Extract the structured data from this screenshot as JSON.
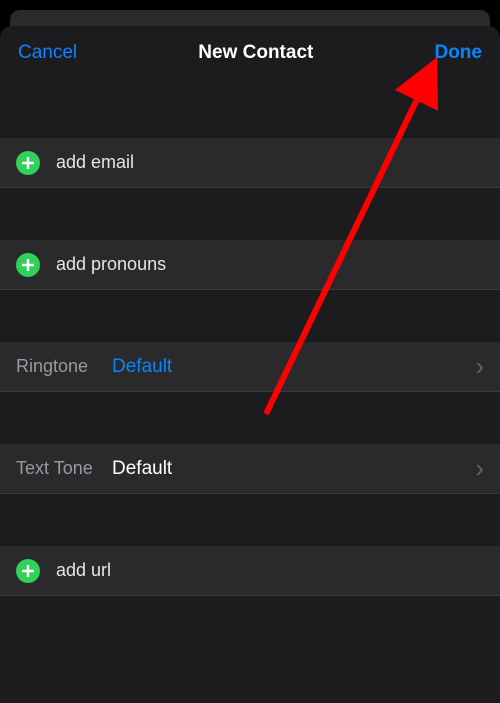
{
  "header": {
    "cancel": "Cancel",
    "title": "New Contact",
    "done": "Done"
  },
  "rows": {
    "email": "add email",
    "pronouns": "add pronouns",
    "url": "add url"
  },
  "ringtone": {
    "label": "Ringtone",
    "value": "Default"
  },
  "texttone": {
    "label": "Text Tone",
    "value": "Default"
  },
  "colors": {
    "accent": "#0a84ff",
    "plus": "#30d158",
    "annotation": "#ff0000"
  }
}
